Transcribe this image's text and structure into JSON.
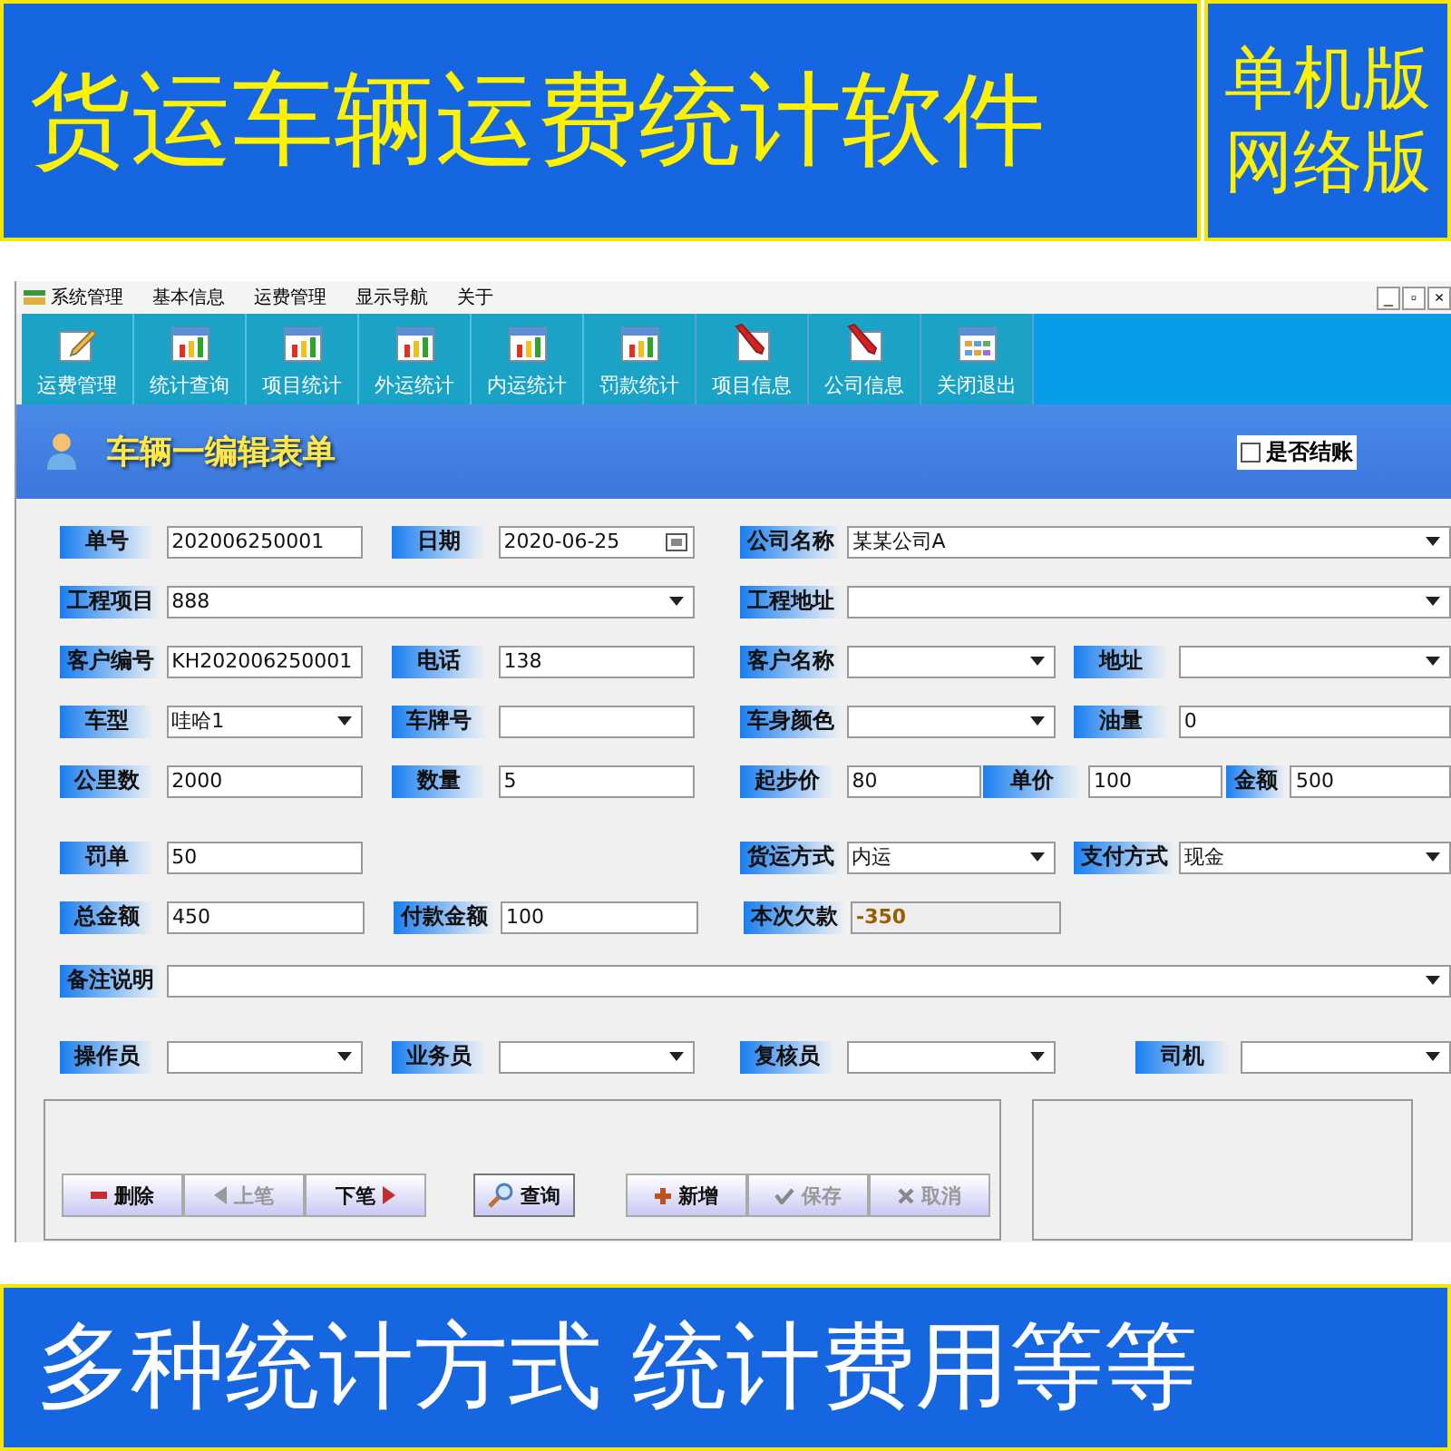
{
  "banner_top": {
    "title": "货运车辆运费统计软件",
    "editions": [
      "单机版",
      "网络版"
    ]
  },
  "menu": [
    "系统管理",
    "基本信息",
    "运费管理",
    "显示导航",
    "关于"
  ],
  "window_controls": [
    "_",
    "▫",
    "×"
  ],
  "toolbar": [
    {
      "label": "运费管理",
      "kind": "edit"
    },
    {
      "label": "统计查询",
      "kind": "chart"
    },
    {
      "label": "项目统计",
      "kind": "chart"
    },
    {
      "label": "外运统计",
      "kind": "chart"
    },
    {
      "label": "内运统计",
      "kind": "chart"
    },
    {
      "label": "罚款统计",
      "kind": "chart"
    },
    {
      "label": "项目信息",
      "kind": "pencil"
    },
    {
      "label": "公司信息",
      "kind": "pencil"
    },
    {
      "label": "关闭退出",
      "kind": "grid"
    }
  ],
  "form": {
    "title": "车辆一编辑表单",
    "settled": {
      "label": "是否结账",
      "checked": false
    },
    "rows": [
      [
        {
          "label": "单号",
          "value": "202006250001",
          "kind": "text"
        },
        {
          "label": "日期",
          "value": "2020-06-25",
          "kind": "date"
        },
        {
          "label": "公司名称",
          "value": "某某公司A",
          "kind": "select"
        }
      ],
      [
        {
          "label": "工程项目",
          "value": "888",
          "kind": "select"
        },
        null,
        {
          "label": "工程地址",
          "kind": "select"
        }
      ],
      [
        {
          "label": "客户编号",
          "value": "KH202006250001",
          "kind": "text"
        },
        {
          "label": "电话",
          "value": "138",
          "kind": "text"
        },
        {
          "label": "客户名称",
          "kind": "select"
        },
        {
          "label": "地址",
          "kind": "select"
        }
      ],
      [
        {
          "label": "车型",
          "value": "哇哈1",
          "kind": "select"
        },
        {
          "label": "车牌号",
          "kind": "text"
        },
        {
          "label": "车身颜色",
          "kind": "select"
        },
        {
          "label": "油量",
          "value": "0",
          "kind": "text"
        }
      ],
      [
        {
          "label": "公里数",
          "value": "2000",
          "kind": "text"
        },
        {
          "label": "数量",
          "value": "5",
          "kind": "text"
        },
        {
          "label": "起步价",
          "value": "80",
          "kind": "text"
        },
        {
          "label": "单价",
          "value": "100",
          "kind": "text"
        },
        {
          "label": "金额",
          "value": "500",
          "kind": "text"
        }
      ],
      [
        {
          "label": "罚单",
          "value": "50",
          "kind": "text"
        },
        null,
        {
          "label": "货运方式",
          "value": "内运",
          "kind": "select"
        },
        {
          "label": "支付方式",
          "value": "现金",
          "kind": "select"
        }
      ],
      [
        {
          "label": "总金额",
          "value": "450",
          "kind": "text"
        },
        {
          "label": "付款金额",
          "value": "100",
          "kind": "text"
        },
        {
          "label": "本次欠款",
          "value": "-350",
          "kind": "readonly"
        }
      ],
      [
        {
          "label": "备注说明",
          "kind": "select"
        }
      ],
      [
        {
          "label": "操作员",
          "kind": "select"
        },
        {
          "label": "业务员",
          "kind": "select"
        },
        {
          "label": "复核员",
          "kind": "select"
        },
        {
          "label": "司机",
          "kind": "select"
        }
      ]
    ]
  },
  "buttons": [
    {
      "label": "删除",
      "kind": "delete",
      "disabled": false
    },
    {
      "label": "上笔",
      "kind": "prev",
      "disabled": true
    },
    {
      "label": "下笔",
      "kind": "next",
      "disabled": false
    },
    {
      "label": "查询",
      "kind": "search",
      "disabled": false
    },
    {
      "label": "新增",
      "kind": "add",
      "disabled": false
    },
    {
      "label": "保存",
      "kind": "save",
      "disabled": true
    },
    {
      "label": "取消",
      "kind": "cancel",
      "disabled": true
    }
  ],
  "banner_bottom": {
    "title": "多种统计方式 统计费用等等"
  }
}
